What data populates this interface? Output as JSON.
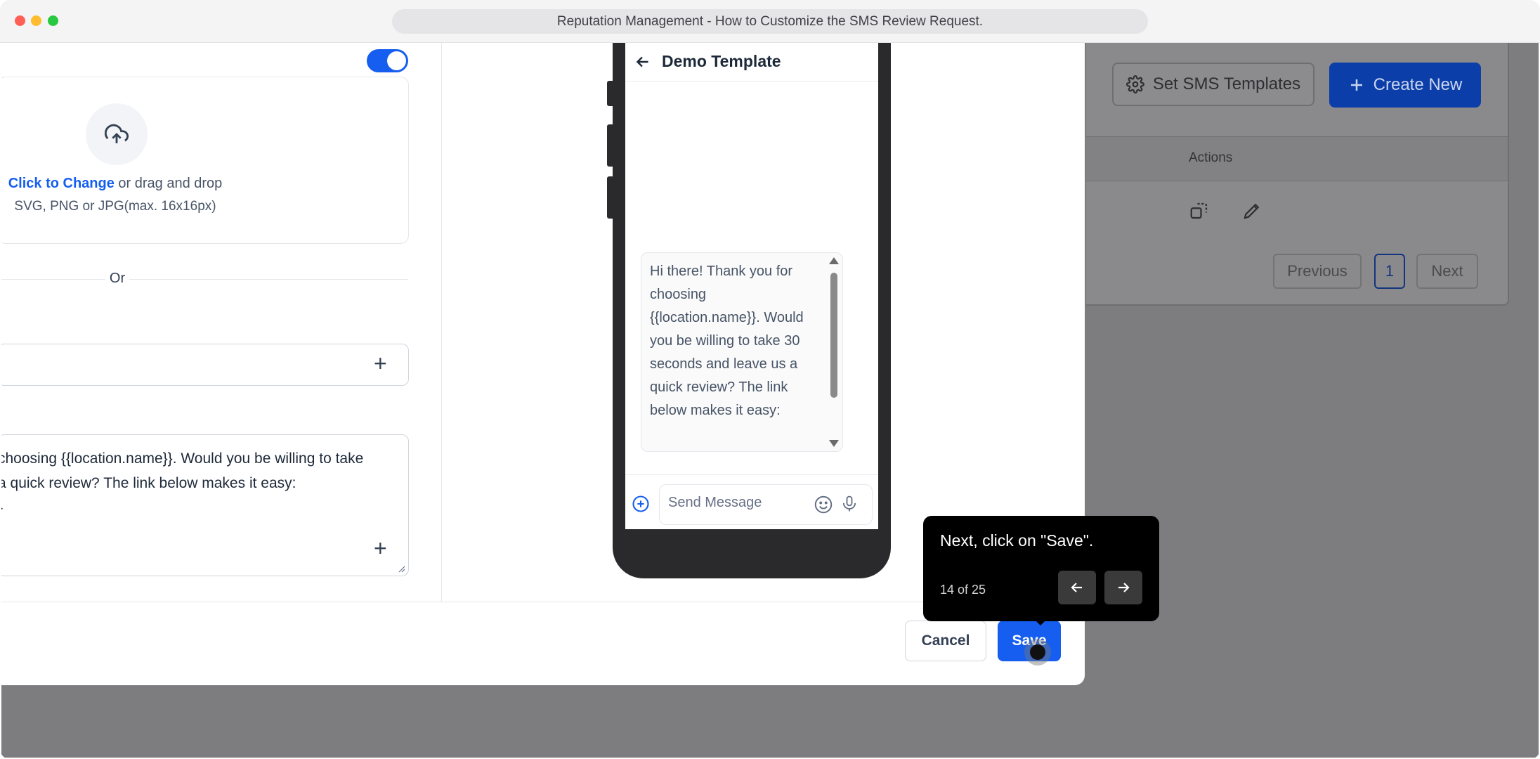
{
  "window": {
    "title": "Reputation Management - How to Customize the SMS Review Request."
  },
  "background": {
    "set_templates_label": "Set SMS Templates",
    "create_new_label": "Create New",
    "table": {
      "actions_header": "Actions"
    },
    "pagination": {
      "previous": "Previous",
      "page": "1",
      "next": "Next"
    }
  },
  "modal": {
    "upload": {
      "link_text": "Click to Change",
      "rest_text": " or drag and drop",
      "hint": "SVG, PNG or JPG(max. 16x16px)"
    },
    "divider_text": "Or",
    "message_lines": [
      "choosing {{location.name}}. Would you be willing to take",
      " a quick review? The link below makes it easy:",
      "}"
    ],
    "preview": {
      "title": "Demo Template",
      "bubble_text": "Hi there! Thank you for choosing {{location.name}}. Would you be willing to take 30 seconds and leave us a quick review? The link below makes it easy:",
      "composer_placeholder": "Send Message"
    },
    "footer": {
      "cancel_label": "Cancel",
      "save_label": "Save"
    }
  },
  "tooltip": {
    "text": "Next, click on \"Save\".",
    "step": "14 of 25"
  },
  "colors": {
    "primary": "#155eef",
    "tooltip_bg": "#000000",
    "overlay": "#7d7d80"
  }
}
